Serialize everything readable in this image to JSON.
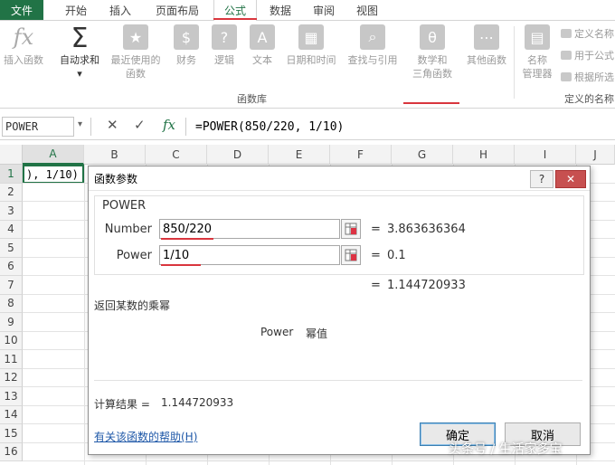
{
  "tabs": {
    "file": "文件",
    "items": [
      "开始",
      "插入",
      "页面布局",
      "公式",
      "数据",
      "审阅",
      "视图"
    ],
    "active_index": 3
  },
  "ribbon": {
    "buttons": {
      "insert_function": "插入函数",
      "autosum": "自动求和",
      "recent_1": "最近使用的",
      "recent_2": "函数",
      "financial": "财务",
      "logical": "逻辑",
      "text": "文本",
      "datetime": "日期和时间",
      "lookup": "查找与引用",
      "math_1": "数学和",
      "math_2": "三角函数",
      "more": "其他函数",
      "name_mgr_1": "名称",
      "name_mgr_2": "管理器",
      "define_name": "定义名称",
      "use_in_formula": "用于公式",
      "create_from_sel": "根据所选"
    },
    "groups": {
      "function_library": "函数库",
      "defined_names": "定义的名称"
    }
  },
  "formula_bar": {
    "name_box": "POWER",
    "cancel_icon": "✕",
    "enter_icon": "✓",
    "fx_label": "fx",
    "formula": "=POWER(850/220, 1/10)"
  },
  "grid": {
    "columns": [
      "A",
      "B",
      "C",
      "D",
      "E",
      "F",
      "G",
      "H",
      "I",
      "J"
    ],
    "rows": [
      "1",
      "2",
      "3",
      "4",
      "5",
      "6",
      "7",
      "8",
      "9",
      "10",
      "11",
      "12",
      "13",
      "14",
      "15",
      "16"
    ],
    "a1_text": "), 1/10)"
  },
  "dialog": {
    "title": "函数参数",
    "help_btn": "?",
    "close_btn": "✕",
    "function_name": "POWER",
    "args": [
      {
        "label": "Number",
        "value": "850/220",
        "result": "3.863636364"
      },
      {
        "label": "Power",
        "value": "1/10",
        "result": "0.1"
      }
    ],
    "equals": "=",
    "overall_result": "1.144720933",
    "description": "返回某数的乘幂",
    "param_name": "Power",
    "param_desc": "幂值",
    "calc_result_label": "计算结果 =",
    "calc_result_value": "1.144720933",
    "help_link": "有关该函数的帮助(H)",
    "ok_button": "确定",
    "cancel_button": "取消"
  },
  "watermark": "头条号 / 生活家多宝",
  "colors": {
    "accent_green": "#217346",
    "underline_red": "#d9363e",
    "link_blue": "#1f58a8"
  }
}
